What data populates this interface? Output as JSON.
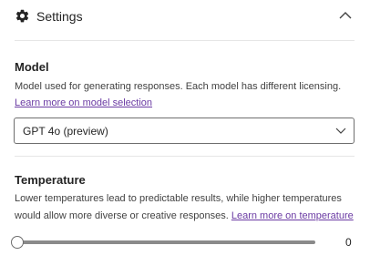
{
  "header": {
    "title": "Settings",
    "icon": "gear-icon",
    "collapse_icon": "chevron-up-icon"
  },
  "model": {
    "title": "Model",
    "description": "Model used for generating responses. Each model has different licensing.",
    "link": "Learn more on model selection",
    "selected": "GPT 4o (preview)"
  },
  "temperature": {
    "title": "Temperature",
    "description_line1": "Lower temperatures lead to predictable results, while higher temperatures",
    "description_line2": "would allow more diverse or creative responses.",
    "link": "Learn more on temperature",
    "value": 0,
    "value_label": "0",
    "level_fraction": 0
  },
  "colors": {
    "link": "#6a3aa3",
    "text": "#242424",
    "divider": "#e6e6e6"
  }
}
